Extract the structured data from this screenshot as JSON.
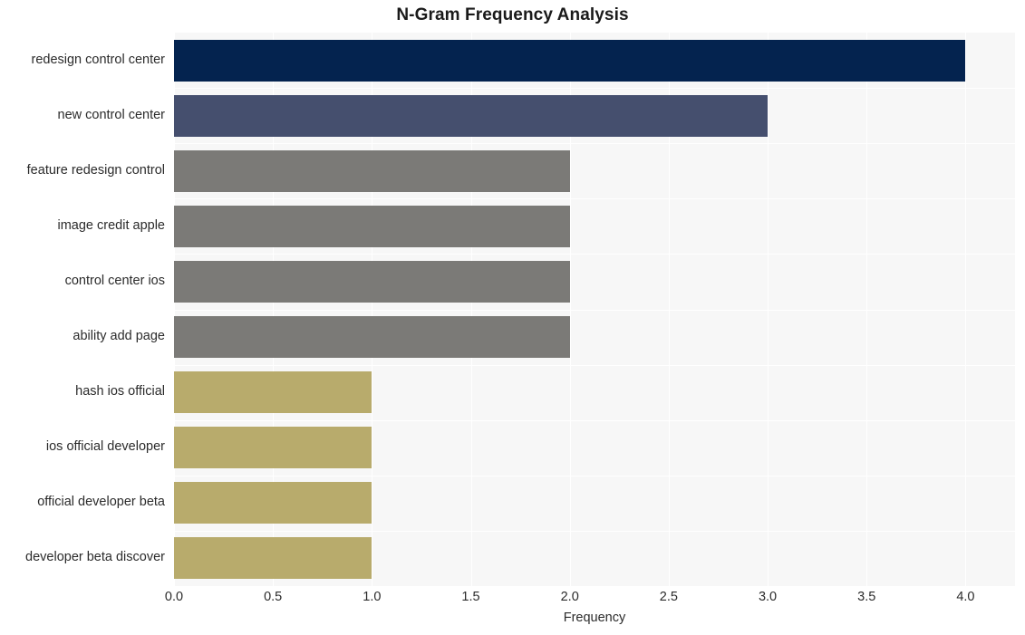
{
  "chart_data": {
    "type": "bar",
    "orientation": "horizontal",
    "title": "N-Gram Frequency Analysis",
    "xlabel": "Frequency",
    "ylabel": "",
    "categories": [
      "redesign control center",
      "new control center",
      "feature redesign control",
      "image credit apple",
      "control center ios",
      "ability add page",
      "hash ios official",
      "ios official developer",
      "official developer beta",
      "developer beta discover"
    ],
    "values": [
      4,
      3,
      2,
      2,
      2,
      2,
      1,
      1,
      1,
      1
    ],
    "bar_colors": [
      "#04234f",
      "#454f6e",
      "#7b7a77",
      "#7b7a77",
      "#7b7a77",
      "#7b7a77",
      "#b8ab6c",
      "#b8ab6c",
      "#b8ab6c",
      "#b8ab6c"
    ],
    "xlim": [
      0,
      4.25
    ],
    "xticks": [
      0,
      0.5,
      1,
      1.5,
      2,
      2.5,
      3,
      3.5,
      4
    ],
    "xtick_labels": [
      "0.0",
      "0.5",
      "1.0",
      "1.5",
      "2.0",
      "2.5",
      "3.0",
      "3.5",
      "4.0"
    ],
    "grid": true,
    "grid_color": "#ffffff",
    "plot_background": "#f7f7f7",
    "figure_background": "#ffffff",
    "legend": null
  }
}
